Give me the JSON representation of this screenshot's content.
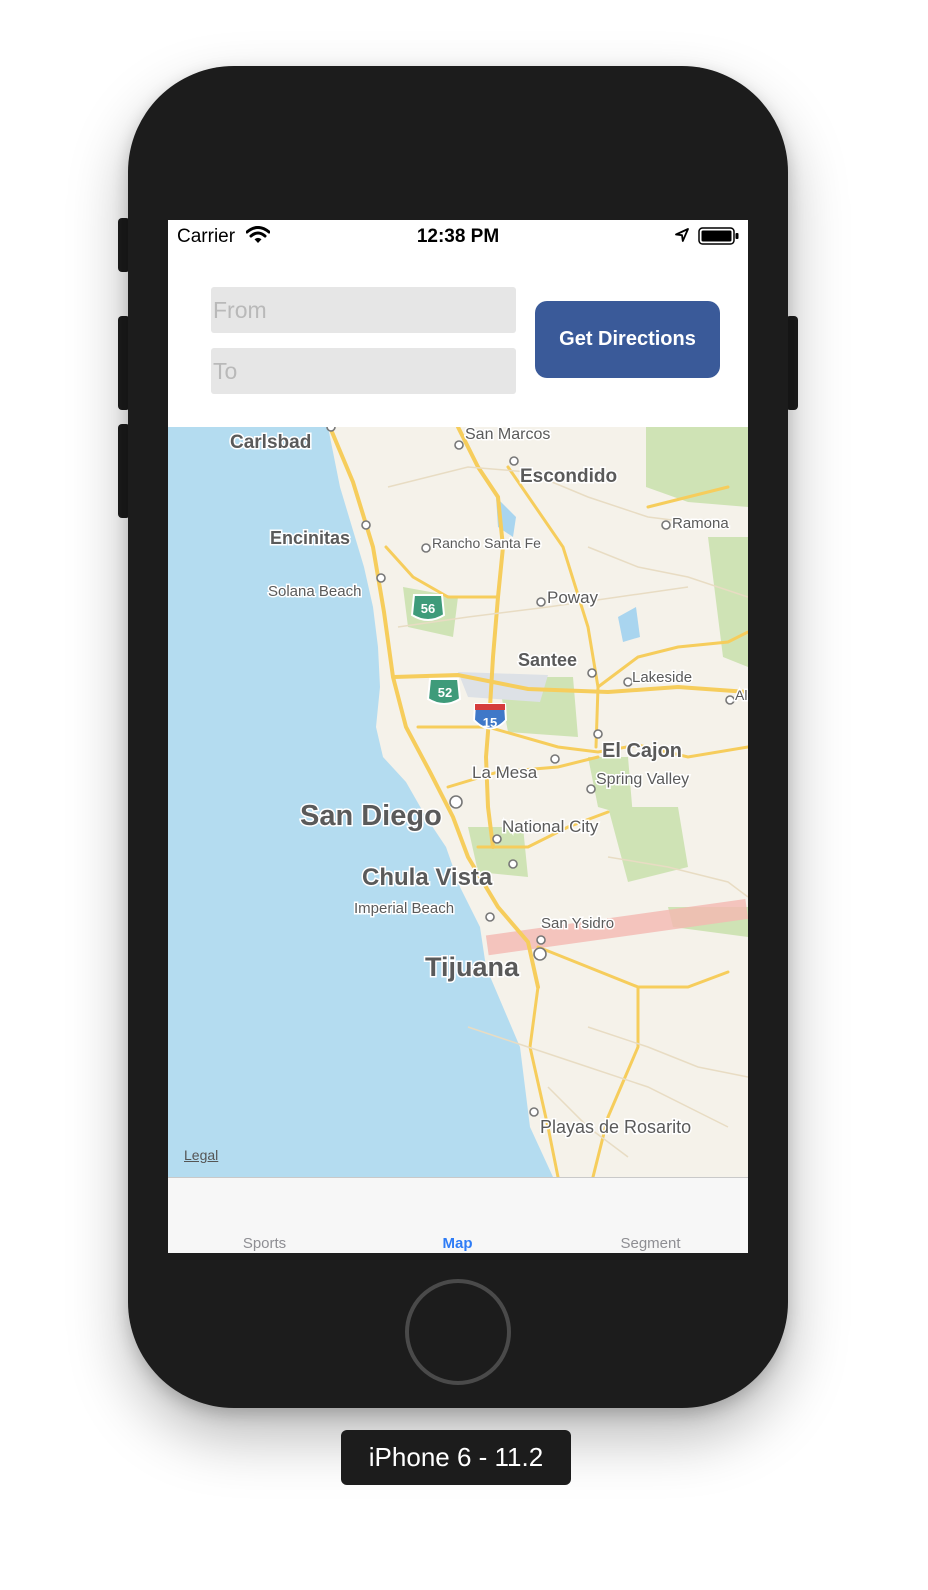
{
  "status_bar": {
    "carrier": "Carrier",
    "time": "12:38 PM"
  },
  "form": {
    "from_placeholder": "From",
    "to_placeholder": "To",
    "from_value": "",
    "to_value": "",
    "directions_label": "Get Directions"
  },
  "map": {
    "legal": "Legal",
    "places": {
      "carlsbad": "Carlsbad",
      "san_marcos": "San Marcos",
      "escondido": "Escondido",
      "ramona": "Ramona",
      "encinitas": "Encinitas",
      "rancho_santa_fe": "Rancho Santa Fe",
      "solana_beach": "Solana Beach",
      "poway": "Poway",
      "santee": "Santee",
      "lakeside": "Lakeside",
      "el_cajon": "El Cajon",
      "la_mesa": "La Mesa",
      "spring_valley": "Spring Valley",
      "san_diego": "San Diego",
      "national_city": "National City",
      "chula_vista": "Chula Vista",
      "imperial_beach": "Imperial Beach",
      "san_ysidro": "San Ysidro",
      "tijuana": "Tijuana",
      "playas_de_rosarito": "Playas de Rosarito",
      "alpine_partial": "Al"
    },
    "shields": {
      "route_56": "56",
      "route_52": "52",
      "interstate_15": "15"
    }
  },
  "tabs": [
    {
      "label": "Sports",
      "active": false
    },
    {
      "label": "Map",
      "active": true
    },
    {
      "label": "Segment",
      "active": false
    }
  ],
  "device_label": "iPhone 6 - 11.2"
}
